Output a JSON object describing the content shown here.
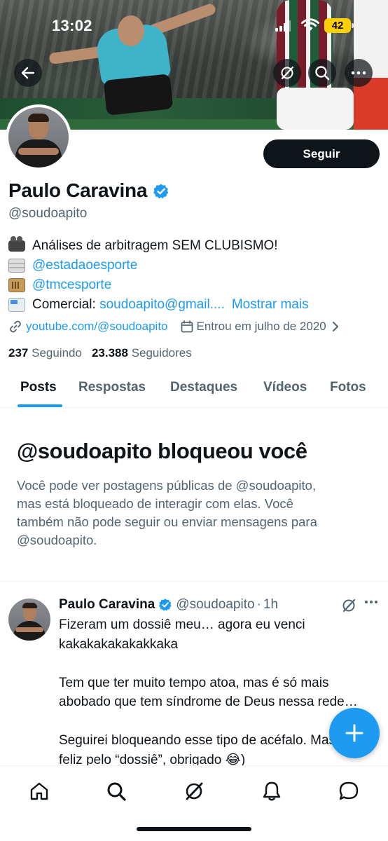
{
  "status_bar": {
    "time": "13:02",
    "battery": "42"
  },
  "profile": {
    "display_name": "Paulo Caravina",
    "handle": "@soudoapito",
    "follow_label": "Seguir",
    "bio": {
      "line1": "Análises de arbitragem SEM CLUBISMO!",
      "line2_link": "@estadaoesporte",
      "line3_link": "@tmcesporte",
      "line4_text": "Comercial: ",
      "line4_link": "soudoapito@gmail....",
      "more": "Mostrar mais"
    },
    "website": "youtube.com/@soudoapito",
    "joined": "Entrou em julho de 2020",
    "following_count": "237",
    "following_label": "Seguindo",
    "followers_count": "23.388",
    "followers_label": "Seguidores"
  },
  "tabs": [
    "Posts",
    "Respostas",
    "Destaques",
    "Vídeos",
    "Fotos"
  ],
  "block_notice": {
    "title": "@soudoapito bloqueou você",
    "line1": "Você pode ver postagens públicas de @soudoapito,",
    "line2": "mas está bloqueado de interagir com elas. Você",
    "line3": "também não pode seguir ou enviar mensagens para",
    "line4": "@soudoapito."
  },
  "tweet": {
    "name": "Paulo Caravina",
    "handle": "@soudoapito",
    "dot": "·",
    "time": "1h",
    "line1": "Fizeram um dossiê meu… agora eu venci",
    "line2": "kakakakakakakkaka",
    "line3": "Tem que ter muito tempo atoa, mas é só mais",
    "line4": "abobado que tem síndrome de Deus nessa rede…",
    "line5": "Seguirei bloqueando esse tipo de acéfalo. Mas",
    "line6": "feliz pelo “dossiê”, obrigado 😂)"
  },
  "colors": {
    "accent": "#1d9bf0",
    "text": "#0f1419",
    "muted": "#536471",
    "battery": "#ffd000"
  },
  "icons": [
    "back-arrow-icon",
    "grok-icon",
    "search-icon",
    "more-icon",
    "verified-badge-icon",
    "link-icon",
    "calendar-icon",
    "chevron-right-icon",
    "plus-icon",
    "home-icon",
    "notifications-icon",
    "messages-icon"
  ]
}
